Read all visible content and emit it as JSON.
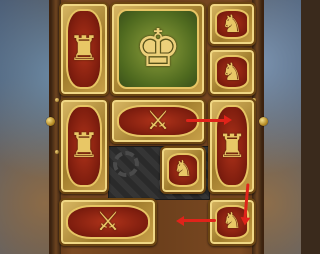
{
  "game": {
    "title": "",
    "pieces": [
      {
        "id": "general",
        "type": "general",
        "icon": "general-warrior-icon"
      },
      {
        "id": "left-top",
        "type": "vertical",
        "icon": "terracotta-soldier-icon"
      },
      {
        "id": "right-top-1",
        "type": "small",
        "icon": "soldier-head-icon"
      },
      {
        "id": "right-top-2",
        "type": "small",
        "icon": "soldier-head-icon"
      },
      {
        "id": "left-mid",
        "type": "vertical",
        "icon": "terracotta-soldier-icon"
      },
      {
        "id": "middle-horizontal",
        "type": "horizontal",
        "icon": "sword-soldier-icon"
      },
      {
        "id": "right-mid",
        "type": "vertical",
        "icon": "terracotta-soldier-icon"
      },
      {
        "id": "center-small",
        "type": "small",
        "icon": "soldier-head-icon"
      },
      {
        "id": "bottom-horizontal",
        "type": "horizontal",
        "icon": "sword-soldier-icon"
      },
      {
        "id": "bottom-right-small",
        "type": "small",
        "icon": "soldier-head-icon"
      }
    ],
    "hints": [
      {
        "name": "hint-arrow-left-to-right"
      },
      {
        "name": "hint-arrow-down"
      },
      {
        "name": "hint-arrow-left"
      }
    ],
    "colors": {
      "tile_gold": "#c9a24a",
      "tile_red": "#7e1d0e",
      "general_green": "#4f6a1f",
      "arrow_red": "#e0231a",
      "board_wood": "#6c3f1c"
    }
  }
}
